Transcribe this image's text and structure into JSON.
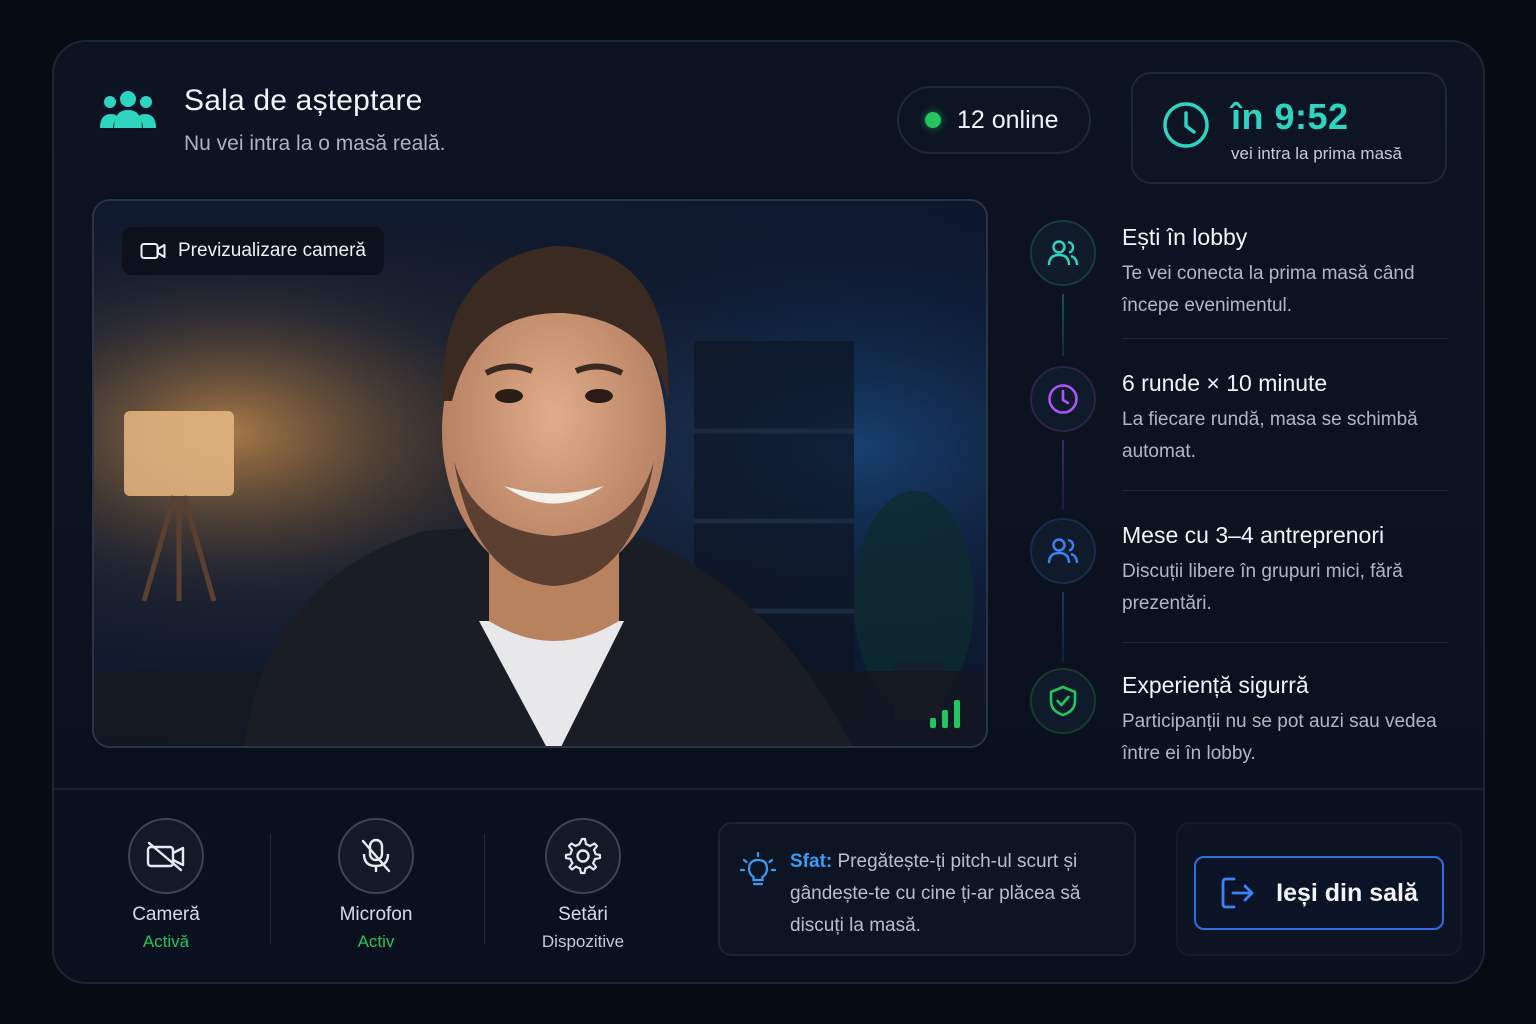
{
  "header": {
    "title": "Sala de așteptare",
    "subtitle": "Nu vei intra la o masă reală.",
    "online": "12 online",
    "timer_main": "în 9:52",
    "timer_sub": "vei intra la prima masă"
  },
  "preview": {
    "label": "Previzualizare cameră"
  },
  "steps": [
    {
      "icon": "users-icon",
      "title": "Ești în lobby",
      "desc": "Te vei conecta la prima masă când începe evenimentul.",
      "color": "#2dd4bf"
    },
    {
      "icon": "clock-icon",
      "title": "6 runde × 10 minute",
      "desc": "La fiecare rundă, masa se schimbă automat.",
      "color": "#a855f7"
    },
    {
      "icon": "users-icon",
      "title": "Mese cu 3–4 antreprenori",
      "desc": "Discuții libere în grupuri mici, fără prezentări.",
      "color": "#3b82f6"
    },
    {
      "icon": "shield-check-icon",
      "title": "Experiență sigurră",
      "desc": "Participanții nu se pot auzi sau vedea între ei în lobby.",
      "color": "#22c55e"
    }
  ],
  "controls": [
    {
      "icon": "camera-off-icon",
      "label": "Cameră",
      "status": "Activă",
      "status_color": "#22c55e"
    },
    {
      "icon": "mic-off-icon",
      "label": "Microfon",
      "status": "Activ",
      "status_color": "#22c55e"
    },
    {
      "icon": "gear-icon",
      "label": "Setări",
      "status": "Dispozitive",
      "status_color": "#c5ccd8"
    }
  ],
  "tip": {
    "label": "Sfat:",
    "text": " Pregătește-ți pitch-ul scurt și gândește-te cu cine ți-ar plăcea să discuți la masă."
  },
  "exit": {
    "label": "Ieși din sală"
  },
  "colors": {
    "accent_teal": "#2dd4bf",
    "online_green": "#22c55e",
    "exit_blue": "#2f6ee0"
  }
}
